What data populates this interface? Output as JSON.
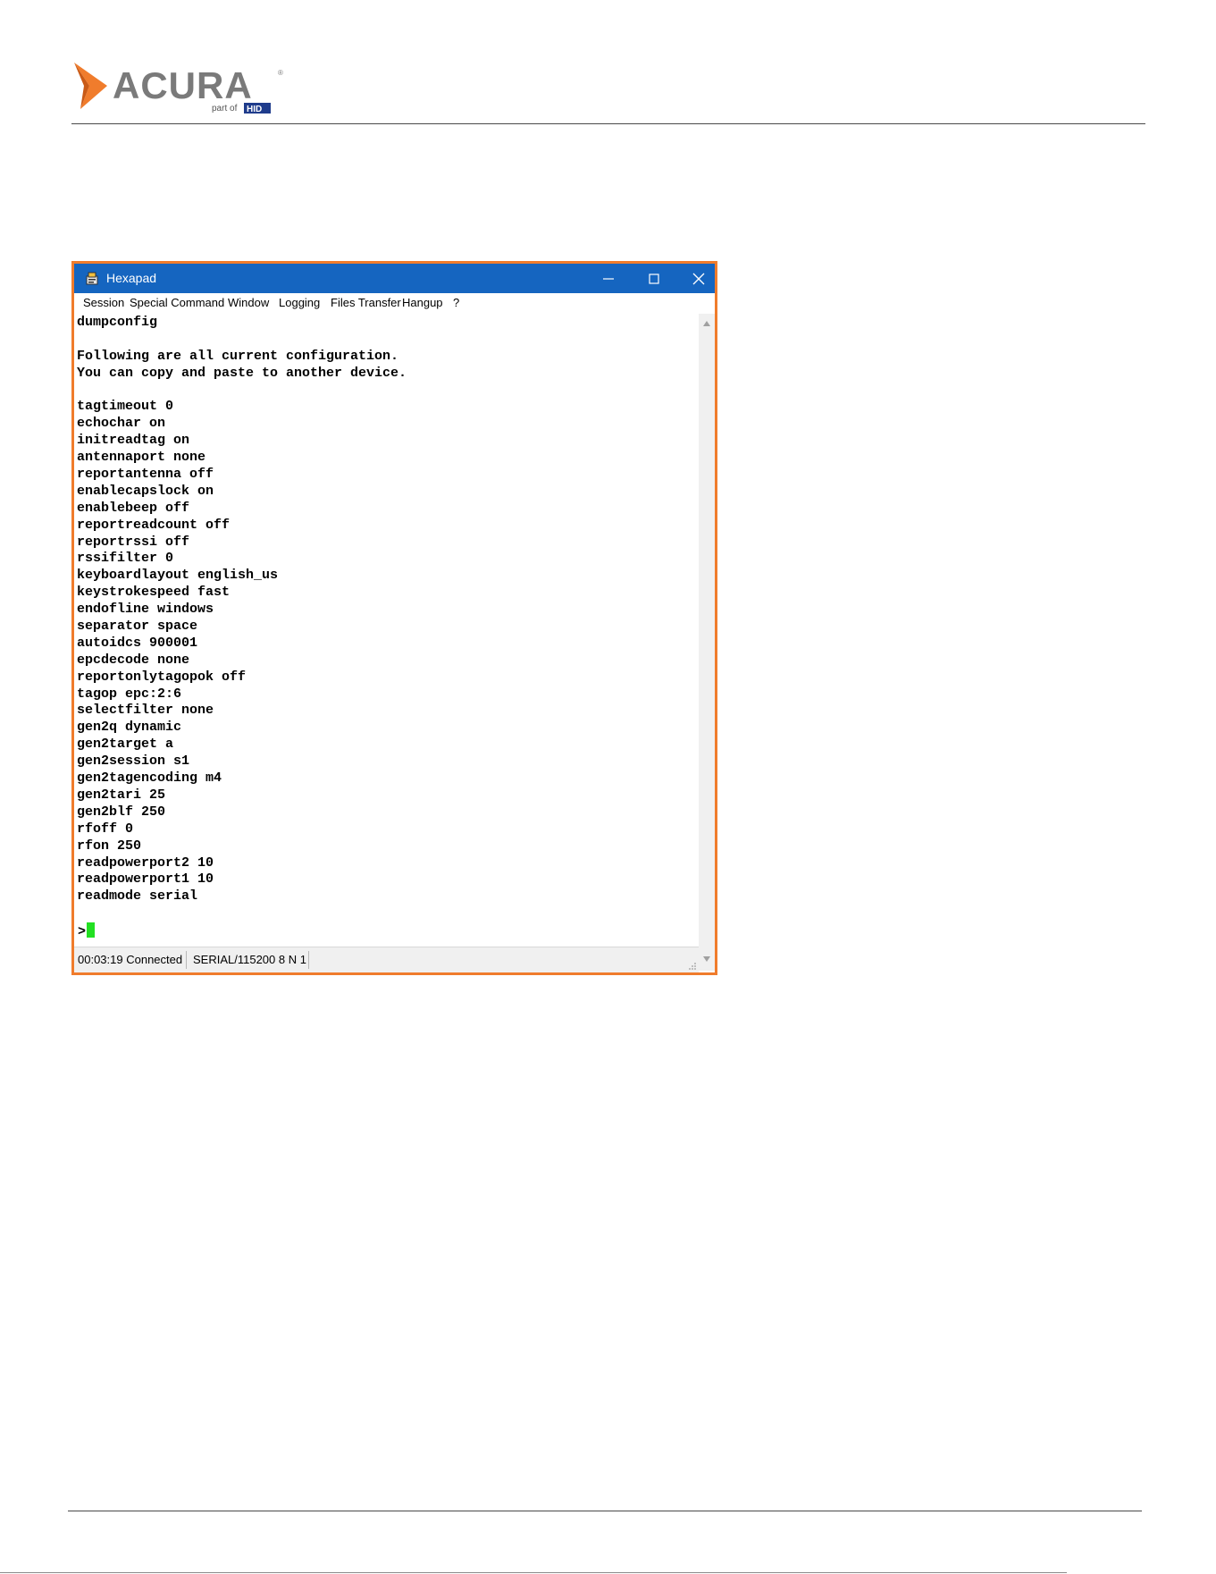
{
  "brand": {
    "name": "ACURA",
    "tagline": "part of",
    "parent": "HID",
    "colors": {
      "orange": "#f07c2c",
      "gray": "#777777",
      "hid_blue": "#1f3c8c"
    }
  },
  "window": {
    "title": "Hexapad",
    "accent": "#1565c0",
    "border_color": "#f07c2c"
  },
  "menu": [
    {
      "label": "Session"
    },
    {
      "label": "Special Command"
    },
    {
      "label": "Window"
    },
    {
      "label": "Logging"
    },
    {
      "label": "Files Transfer"
    },
    {
      "label": "Hangup"
    },
    {
      "label": "?"
    }
  ],
  "terminal": {
    "lines": [
      "dumpconfig",
      "",
      "Following are all current configuration.",
      "You can copy and paste to another device.",
      "",
      "tagtimeout 0",
      "echochar on",
      "initreadtag on",
      "antennaport none",
      "reportantenna off",
      "enablecapslock on",
      "enablebeep off",
      "reportreadcount off",
      "reportrssi off",
      "rssifilter 0",
      "keyboardlayout english_us",
      "keystrokespeed fast",
      "endofline windows",
      "separator space",
      "autoidcs 900001",
      "epcdecode none",
      "reportonlytagopok off",
      "tagop epc:2:6",
      "selectfilter none",
      "gen2q dynamic",
      "gen2target a",
      "gen2session s1",
      "gen2tagencoding m4",
      "gen2tari 25",
      "gen2blf 250",
      "rfoff 0",
      "rfon 250",
      "readpowerport2 10",
      "readpowerport1 10",
      "readmode serial"
    ],
    "prompt": ">",
    "cursor_color": "#22e022"
  },
  "status": {
    "connection": "00:03:19 Connected",
    "port": "SERIAL/115200 8 N 1"
  }
}
